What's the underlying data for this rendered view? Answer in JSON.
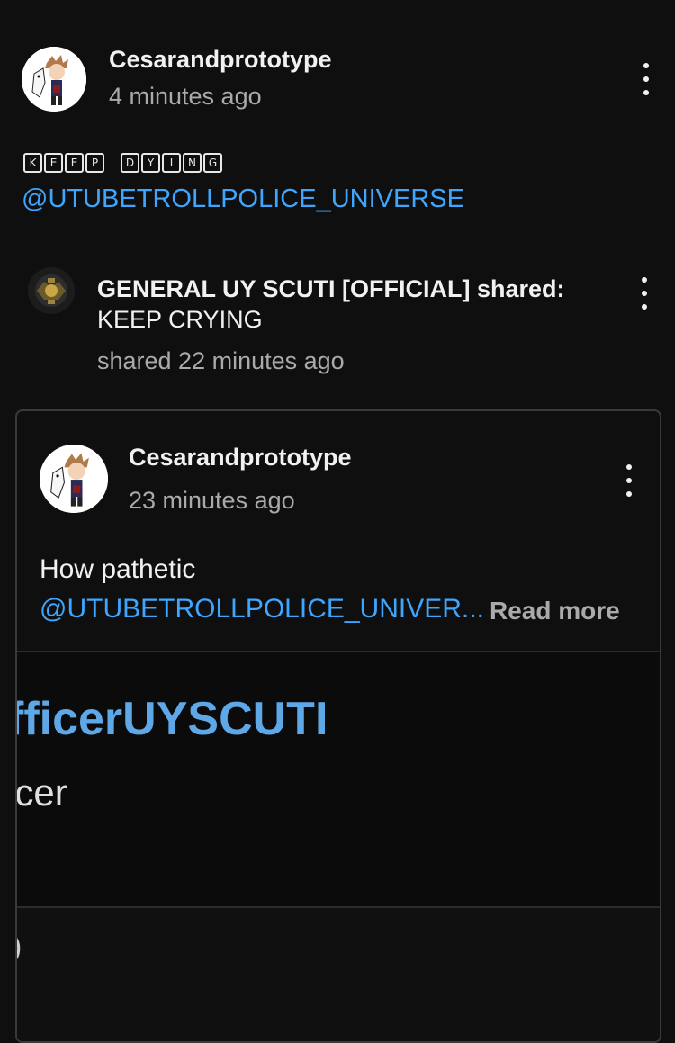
{
  "post": {
    "author": "Cesarandprototype",
    "time": "4 minutes ago",
    "title_chars": [
      "K",
      "E",
      "E",
      "P",
      " ",
      "D",
      "Y",
      "I",
      "N",
      "G"
    ],
    "mention": "@UTUBETROLLPOLICE_UNIVERSE"
  },
  "share": {
    "line1": "GENERAL UY SCUTI [OFFICIAL] shared:",
    "line2": "KEEP CRYING",
    "time": "shared 22 minutes ago"
  },
  "original": {
    "author": "Cesarandprototype",
    "time": "23 minutes ago",
    "text": "How pathetic",
    "mention": "@UTUBETROLLPOLICE_UNIVER...",
    "read_more": "Read more"
  },
  "preview": {
    "handle": "fficerUYSCUTI",
    "subtitle": "icer",
    "lower_glyph": ")"
  },
  "colors": {
    "background": "#0f0f0f",
    "link": "#3ea6ff",
    "muted": "#aaaaaa",
    "card_border": "#3a3a3a"
  },
  "icons": [
    "avatar-image",
    "more-vert-icon"
  ]
}
